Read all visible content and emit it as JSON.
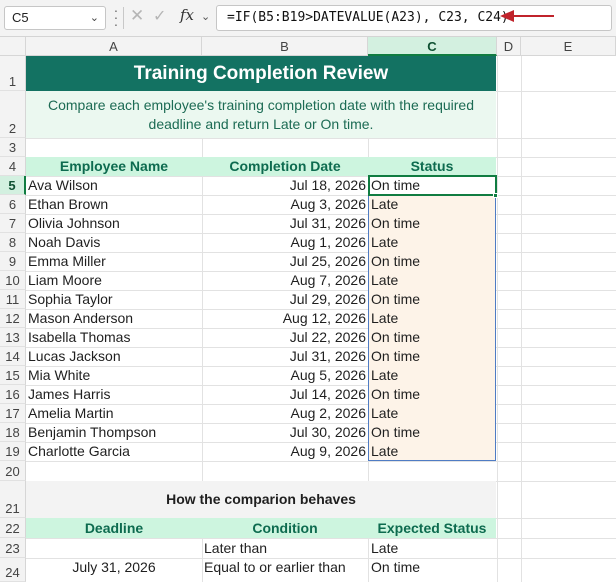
{
  "formula_bar": {
    "name_box": "C5",
    "formula": "=IF(B5:B19>DATEVALUE(A23), C23, C24)",
    "fx_label": "fx"
  },
  "columns": [
    "A",
    "B",
    "C",
    "D",
    "E"
  ],
  "selected_column": "C",
  "selected_row": "5",
  "rows": [
    "1",
    "2",
    "3",
    "4",
    "5",
    "6",
    "7",
    "8",
    "9",
    "10",
    "11",
    "12",
    "13",
    "14",
    "15",
    "16",
    "17",
    "18",
    "19",
    "20",
    "21",
    "22",
    "23",
    "24"
  ],
  "sheet": {
    "title": "Training Completion Review",
    "subtitle": "Compare each employee's training completion date with the required deadline and return Late or On time.",
    "headers": {
      "name": "Employee Name",
      "date": "Completion Date",
      "status": "Status"
    },
    "records": [
      {
        "name": "Ava Wilson",
        "date": "Jul 18, 2026",
        "status": "On time"
      },
      {
        "name": "Ethan Brown",
        "date": "Aug 3, 2026",
        "status": "Late"
      },
      {
        "name": "Olivia Johnson",
        "date": "Jul 31, 2026",
        "status": "On time"
      },
      {
        "name": "Noah Davis",
        "date": "Aug 1, 2026",
        "status": "Late"
      },
      {
        "name": "Emma Miller",
        "date": "Jul 25, 2026",
        "status": "On time"
      },
      {
        "name": "Liam Moore",
        "date": "Aug 7, 2026",
        "status": "Late"
      },
      {
        "name": "Sophia Taylor",
        "date": "Jul 29, 2026",
        "status": "On time"
      },
      {
        "name": "Mason Anderson",
        "date": "Aug 12, 2026",
        "status": "Late"
      },
      {
        "name": "Isabella Thomas",
        "date": "Jul 22, 2026",
        "status": "On time"
      },
      {
        "name": "Lucas Jackson",
        "date": "Jul 31, 2026",
        "status": "On time"
      },
      {
        "name": "Mia White",
        "date": "Aug 5, 2026",
        "status": "Late"
      },
      {
        "name": "James Harris",
        "date": "Jul 14, 2026",
        "status": "On time"
      },
      {
        "name": "Amelia Martin",
        "date": "Aug 2, 2026",
        "status": "Late"
      },
      {
        "name": "Benjamin Thompson",
        "date": "Jul 30, 2026",
        "status": "On time"
      },
      {
        "name": "Charlotte Garcia",
        "date": "Aug 9, 2026",
        "status": "Late"
      }
    ],
    "comparison": {
      "title": "How the comparion behaves",
      "headers": {
        "deadline": "Deadline",
        "condition": "Condition",
        "expected": "Expected Status"
      },
      "deadline_value": "July 31, 2026",
      "rows": [
        {
          "condition": "Later than",
          "expected": "Late"
        },
        {
          "condition": "Equal to or earlier than",
          "expected": "On time"
        }
      ]
    }
  },
  "colors": {
    "title_bg": "#137262",
    "header_band": "#cdf5df",
    "status_fill": "#fdf3e8",
    "selection_green": "#107c41",
    "arrow_red": "#c0232b"
  }
}
